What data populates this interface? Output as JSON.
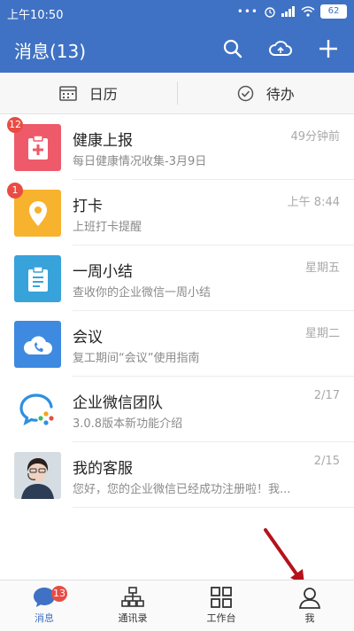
{
  "status_bar": {
    "time": "上午10:50",
    "dots": "•••",
    "battery": "62"
  },
  "app_bar": {
    "title": "消息(13)"
  },
  "quick": {
    "calendar_label": "日历",
    "todo_label": "待办"
  },
  "messages": [
    {
      "name": "健康上报",
      "preview": "每日健康情况收集-3月9日",
      "time": "49分钟前",
      "badge": "12",
      "color": "#ee5a6a"
    },
    {
      "name": "打卡",
      "preview": "上班打卡提醒",
      "time": "上午 8:44",
      "badge": "1",
      "color": "#f7b22e"
    },
    {
      "name": "一周小结",
      "preview": "查收你的企业微信一周小结",
      "time": "星期五",
      "badge": "",
      "color": "#38a2db"
    },
    {
      "name": "会议",
      "preview": "复工期间“会议”使用指南",
      "time": "星期二",
      "badge": "",
      "color": "#3d8ae0"
    },
    {
      "name": "企业微信团队",
      "preview": "3.0.8版本新功能介绍",
      "time": "2/17",
      "badge": "",
      "color": "#ffffff"
    },
    {
      "name": "我的客服",
      "preview": "您好，您的企业微信已经成功注册啦！我...",
      "time": "2/15",
      "badge": "",
      "color": "#cdd6dc"
    }
  ],
  "bottom_nav": {
    "items": [
      {
        "label": "消息",
        "badge": "13"
      },
      {
        "label": "通讯录"
      },
      {
        "label": "工作台"
      },
      {
        "label": "我"
      }
    ]
  },
  "colors": {
    "primary": "#3f72c4",
    "badge": "#e94c44"
  }
}
